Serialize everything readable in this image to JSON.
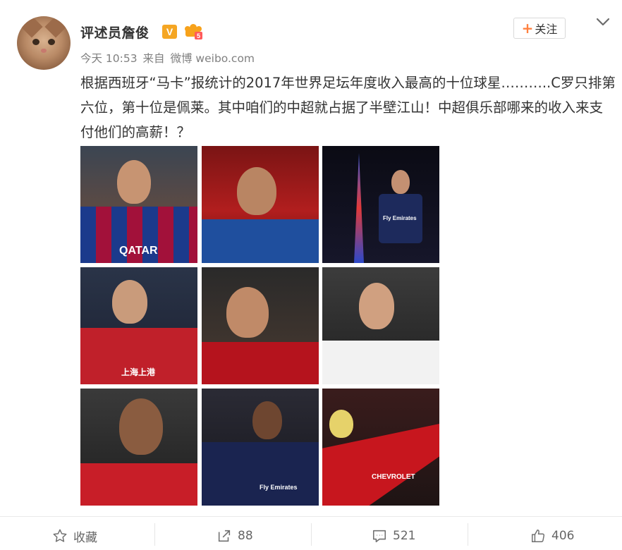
{
  "user": {
    "name": "评述员詹俊",
    "verified_badge": "V"
  },
  "header": {
    "follow_label": "关注",
    "follow_plus": "+"
  },
  "meta": {
    "time": "今天 10:53",
    "from_prefix": "来自",
    "source": "微博 weibo.com"
  },
  "post": {
    "text": "根据西班牙“马卡”报统计的2017年世界足坛年度收入最高的十位球星………..C罗只排第六位，第十位是佩莱。其中咱们的中超就占据了半壁江山！中超俱乐部哪来的收入来支付他们的高薪！？"
  },
  "photos": [
    {
      "name": "photo-messi",
      "shirt_text": "QATAR"
    },
    {
      "name": "photo-tevez",
      "shirt_text": ""
    },
    {
      "name": "photo-neymar",
      "shirt_text": "Fly Emirates"
    },
    {
      "name": "photo-oscar",
      "shirt_text": "上海上港"
    },
    {
      "name": "photo-lavezzi",
      "shirt_text": ""
    },
    {
      "name": "photo-ronaldo",
      "shirt_text": ""
    },
    {
      "name": "photo-hulk",
      "shirt_text": ""
    },
    {
      "name": "photo-mbappe",
      "shirt_text": "Fly Emirates"
    },
    {
      "name": "photo-pogba",
      "shirt_text": "CHEVROLET"
    }
  ],
  "actions": {
    "favorite_label": "收藏",
    "repost_count": "88",
    "comment_count": "521",
    "like_count": "406"
  },
  "colors": {
    "accent_orange": "#ff8140",
    "verified_gold": "#f5a623",
    "meta_gray": "#808080"
  }
}
